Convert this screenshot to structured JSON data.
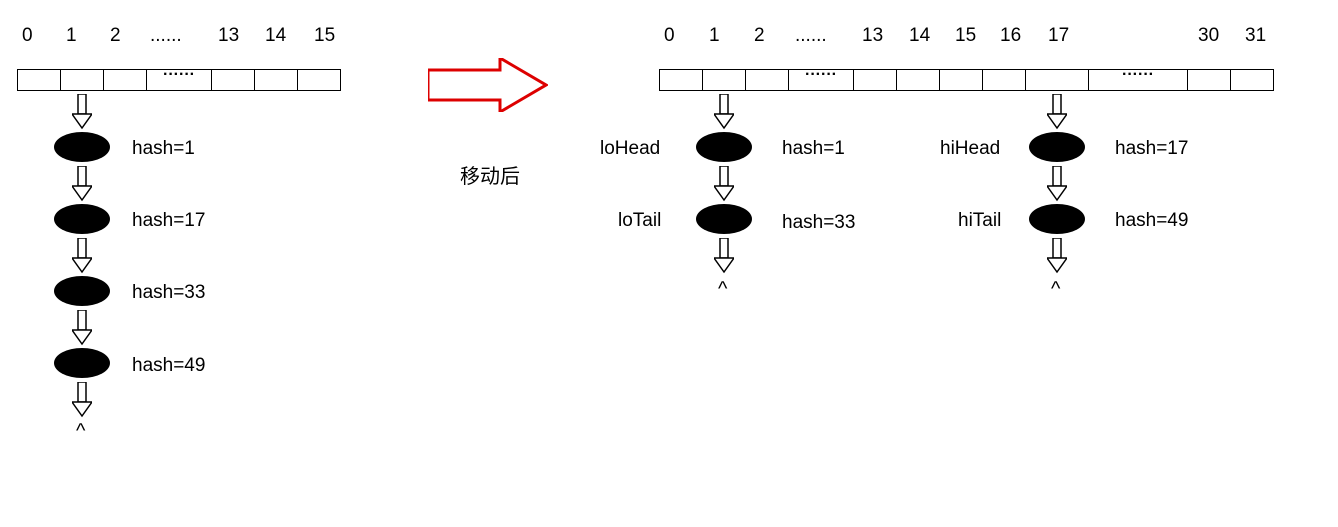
{
  "left": {
    "indices": [
      "0",
      "1",
      "2",
      "......",
      "13",
      "14",
      "15"
    ],
    "chain": [
      {
        "hash": "hash=1"
      },
      {
        "hash": "hash=17"
      },
      {
        "hash": "hash=33"
      },
      {
        "hash": "hash=49"
      }
    ],
    "terminator": "^"
  },
  "center": {
    "label": "移动后"
  },
  "right": {
    "indices": [
      "0",
      "1",
      "2",
      "......",
      "13",
      "14",
      "15",
      "16",
      "17",
      "......",
      "30",
      "31"
    ],
    "lo": {
      "head_label": "loHead",
      "tail_label": "loTail",
      "nodes": [
        {
          "hash": "hash=1"
        },
        {
          "hash": "hash=33"
        }
      ],
      "terminator": "^"
    },
    "hi": {
      "head_label": "hiHead",
      "tail_label": "hiTail",
      "nodes": [
        {
          "hash": "hash=17"
        },
        {
          "hash": "hash=49"
        }
      ],
      "terminator": "^"
    }
  },
  "chart_data": {
    "type": "diagram",
    "title": "HashMap resize split linked list",
    "before": {
      "capacity": 16,
      "bucket_index": 1,
      "chain_hashes": [
        1,
        17,
        33,
        49
      ]
    },
    "after": {
      "capacity": 32,
      "lo_bucket_index": 1,
      "lo_chain_hashes": [
        1,
        33
      ],
      "hi_bucket_index": 17,
      "hi_chain_hashes": [
        17,
        49
      ]
    }
  }
}
